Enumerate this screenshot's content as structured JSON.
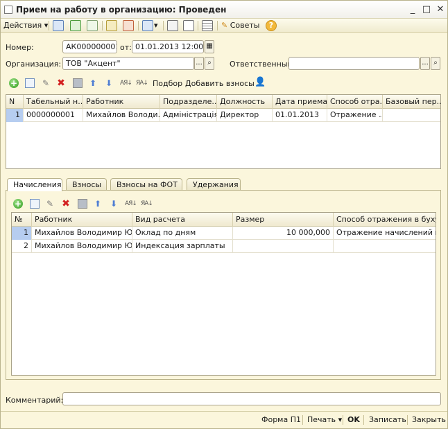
{
  "window": {
    "title": "Прием на работу в организацию: Проведен",
    "minimize": "_",
    "maximize": "□",
    "close": "✕"
  },
  "toolbar": {
    "actions_label": "Действия",
    "actions_arrow": "▾",
    "advice_label": "Советы",
    "help_glyph": "?"
  },
  "form": {
    "number_label": "Номер:",
    "number_value": "АК000000001",
    "date_label": "от:",
    "date_value": "01.01.2013 12:00:00",
    "organization_label": "Организация:",
    "organization_value": "ТОВ \"Акцент\"",
    "responsible_label": "Ответственный:",
    "responsible_value": "",
    "select_glyph": "...",
    "search_glyph": "⌕",
    "calendar_glyph": "▦"
  },
  "employees_toolbar": {
    "add_glyph": "+",
    "edit_glyph": "✎",
    "delete_glyph": "✖",
    "up_glyph": "⬆",
    "down_glyph": "⬇",
    "sort_asc_glyph": "AЯ↓",
    "sort_desc_glyph": "ЯA↓",
    "pick_label": "Подбор",
    "add_contributions_label": "Добавить взносы",
    "person_glyph": "👤"
  },
  "employees_table": {
    "headers": [
      "N",
      "Табельный н...",
      "Работник",
      "Подразделе...",
      "Должность",
      "Дата приема",
      "Способ отра...",
      "Базовый пер..."
    ],
    "rows": [
      [
        "1",
        "0000000001",
        "Михайлов Володи...",
        "Адміністрація",
        "Директор",
        "01.01.2013",
        "Отражение ...",
        ""
      ]
    ]
  },
  "tabs": [
    "Начисления",
    "Взносы",
    "Взносы на ФОТ",
    "Удержания"
  ],
  "accruals_table": {
    "headers": [
      "№",
      "Работник",
      "Вид расчета",
      "Размер",
      "Способ отражения в буху..."
    ],
    "rows": [
      [
        "1",
        "Михайлов Володимир Ю...",
        "Оклад по дням",
        "10 000,000",
        "Отражение начислений п..."
      ],
      [
        "2",
        "Михайлов Володимир Ю...",
        "Индексация зарплаты",
        "",
        ""
      ]
    ]
  },
  "comment": {
    "label": "Комментарий:",
    "value": ""
  },
  "footer": {
    "form_p1": "Форма П1",
    "print": "Печать",
    "print_arrow": "▾",
    "ok": "OK",
    "save": "Записать",
    "close": "Закрыть"
  }
}
